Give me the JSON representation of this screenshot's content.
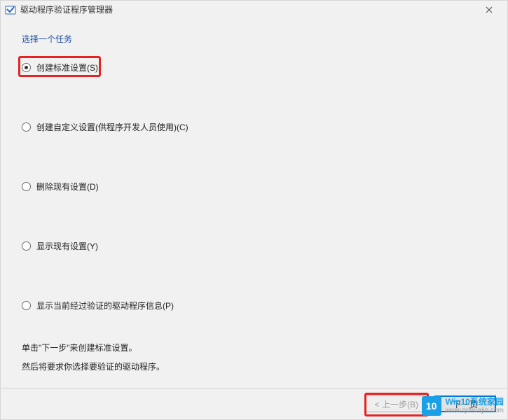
{
  "window": {
    "title": "驱动程序验证程序管理器"
  },
  "prompt": "选择一个任务",
  "options": [
    {
      "label": "创建标准设置(S)",
      "checked": true
    },
    {
      "label": "创建自定义设置(供程序开发人员使用)(C)",
      "checked": false
    },
    {
      "label": "删除现有设置(D)",
      "checked": false
    },
    {
      "label": "显示现有设置(Y)",
      "checked": false
    },
    {
      "label": "显示当前经过验证的驱动程序信息(P)",
      "checked": false
    }
  ],
  "help": {
    "line1": "单击\"下一步\"来创建标准设置。",
    "line2": "然后将要求你选择要验证的驱动程序。"
  },
  "buttons": {
    "back": "< 上一步(B)",
    "next": "下一页"
  },
  "watermark": {
    "badge": "10",
    "brand_prefix": "Win10",
    "brand_suffix": "系统家园",
    "url": "www.qdhuajin.com"
  }
}
